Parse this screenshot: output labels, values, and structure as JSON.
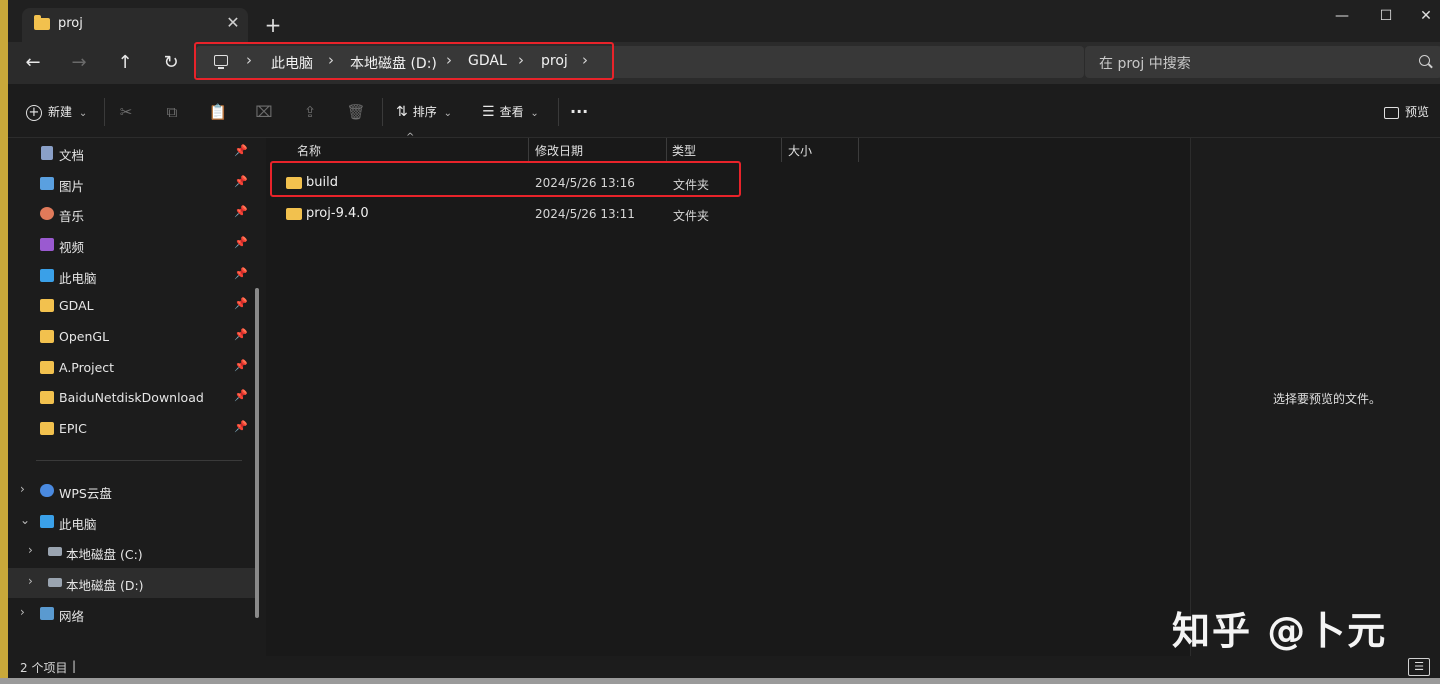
{
  "window": {
    "tab_title": "proj",
    "tab_close": "✕",
    "new_tab": "+",
    "minimize": "—",
    "maximize": "☐",
    "close": "✕"
  },
  "nav": {
    "back": "←",
    "forward": "→",
    "up": "↑",
    "refresh": "↻",
    "breadcrumbs": [
      "此电脑",
      "本地磁盘 (D:)",
      "GDAL",
      "proj"
    ],
    "separator": "›",
    "search_placeholder": "在 proj 中搜索"
  },
  "toolbar": {
    "new_label": "新建",
    "sort_label": "排序",
    "view_label": "查看",
    "more": "···",
    "preview_label": "预览",
    "dropdown": "⌄"
  },
  "sidebar": {
    "quick_access": [
      {
        "label": "文档",
        "icon": "documents-icon",
        "pinned": true
      },
      {
        "label": "图片",
        "icon": "pictures-icon",
        "pinned": true
      },
      {
        "label": "音乐",
        "icon": "music-icon",
        "pinned": true
      },
      {
        "label": "视频",
        "icon": "videos-icon",
        "pinned": true
      },
      {
        "label": "此电脑",
        "icon": "computer-icon",
        "pinned": true
      },
      {
        "label": "GDAL",
        "icon": "folder-icon",
        "pinned": true
      },
      {
        "label": "OpenGL",
        "icon": "folder-icon",
        "pinned": true
      },
      {
        "label": "A.Project",
        "icon": "folder-icon",
        "pinned": true
      },
      {
        "label": "BaiduNetdiskDownload",
        "icon": "folder-icon",
        "pinned": true
      },
      {
        "label": "EPIC",
        "icon": "folder-icon",
        "pinned": true
      }
    ],
    "tree": [
      {
        "label": "WPS云盘",
        "icon": "cloud-icon",
        "chevron": "›"
      },
      {
        "label": "此电脑",
        "icon": "computer-icon",
        "chevron": "⌄"
      },
      {
        "label": "本地磁盘 (C:)",
        "icon": "drive-icon",
        "chevron": "›"
      },
      {
        "label": "本地磁盘 (D:)",
        "icon": "drive-icon",
        "chevron": "›",
        "selected": true
      },
      {
        "label": "网络",
        "icon": "network-icon",
        "chevron": "›"
      }
    ],
    "pin_glyph": "📌"
  },
  "columns": {
    "name": "名称",
    "modified": "修改日期",
    "type": "类型",
    "size": "大小",
    "sort_indicator": "^"
  },
  "files": [
    {
      "name": "build",
      "modified": "2024/5/26 13:16",
      "type": "文件夹",
      "size": "",
      "highlighted": true
    },
    {
      "name": "proj-9.4.0",
      "modified": "2024/5/26 13:11",
      "type": "文件夹",
      "size": ""
    }
  ],
  "preview": {
    "empty_text": "选择要预览的文件。"
  },
  "watermark": "知乎 @卜元",
  "status": {
    "item_count": "2 个项目",
    "sep": "|"
  },
  "colors": {
    "highlight_red": "#e8232a",
    "folder_yellow": "#f2c14e",
    "background": "#1c1c1c"
  }
}
